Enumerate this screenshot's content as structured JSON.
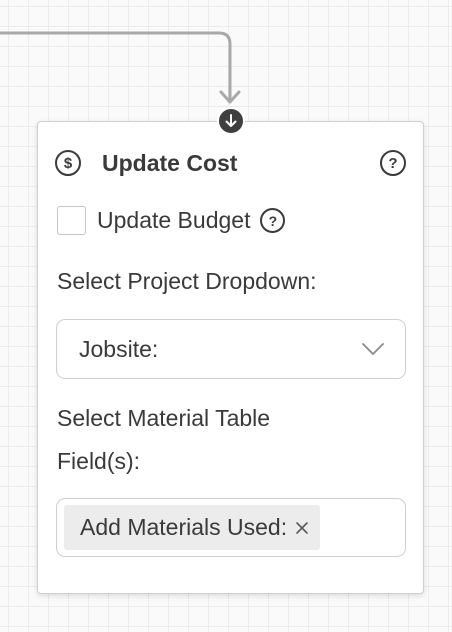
{
  "node": {
    "title": "Update Cost",
    "title_icon": "dollar-circle-icon",
    "title_icon_glyph": "$",
    "help_icon": "question-circle-icon",
    "help_glyph": "?",
    "input_port_icon": "arrow-down-circle-icon"
  },
  "form": {
    "update_budget": {
      "label": "Update Budget",
      "checked": false,
      "help_glyph": "?"
    },
    "project_dropdown": {
      "label": "Select Project Dropdown:",
      "value": "Jobsite:",
      "icon": "chevron-down-icon"
    },
    "material_fields": {
      "label": "Select Material Table Field(s):",
      "tags": [
        {
          "label": "Add Materials Used:",
          "remove_icon": "close-icon"
        }
      ]
    }
  },
  "colors": {
    "canvas": "#fafafa",
    "grid": "#ececec",
    "card": "#ffffff",
    "border": "#cfcfcf",
    "text": "#3a3a3a",
    "port": "#3f3f3f",
    "connector": "#a9a9a9",
    "tag": "#ececec"
  }
}
